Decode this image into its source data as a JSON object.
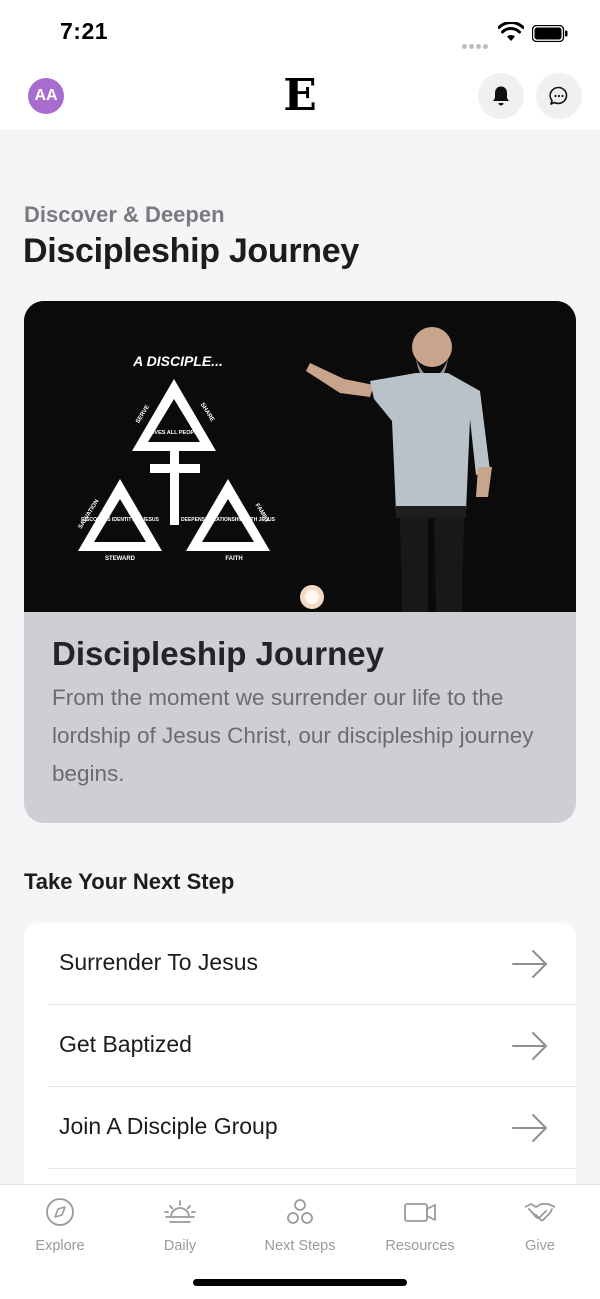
{
  "status": {
    "time": "7:21"
  },
  "header": {
    "avatar_initials": "AA",
    "logo": "E"
  },
  "page": {
    "subtitle": "Discover & Deepen",
    "title": "Discipleship Journey"
  },
  "hero": {
    "title": "Discipleship Journey",
    "description": "From the moment we surrender our life to the lordship of Jesus Christ, our discipleship journey begins.",
    "graphic": {
      "heading": "A DISCIPLE...",
      "top_label": "LOVES ALL PEOPLE",
      "left_label": "DISCOVERS IDENTITY IN JESUS",
      "right_label": "DEEPENS RELATIONSHIP WITH JESUS",
      "side_serve": "SERVE",
      "side_share": "SHARE",
      "side_salvation": "SALVATION",
      "side_family": "FAMILY",
      "bottom_steward": "STEWARD",
      "bottom_faith": "FAITH"
    }
  },
  "next_steps": {
    "title": "Take Your Next Step",
    "items": [
      {
        "label": "Surrender To Jesus"
      },
      {
        "label": "Get Baptized"
      },
      {
        "label": "Join A Disciple Group"
      }
    ]
  },
  "tabs": [
    {
      "label": "Explore",
      "icon": "compass-icon"
    },
    {
      "label": "Daily",
      "icon": "sunrise-icon"
    },
    {
      "label": "Next Steps",
      "icon": "circles-icon"
    },
    {
      "label": "Resources",
      "icon": "video-icon"
    },
    {
      "label": "Give",
      "icon": "handshake-icon"
    }
  ],
  "colors": {
    "avatar": "#a86ccf",
    "background": "#f5f5f7",
    "card": "#cfcfd3"
  }
}
